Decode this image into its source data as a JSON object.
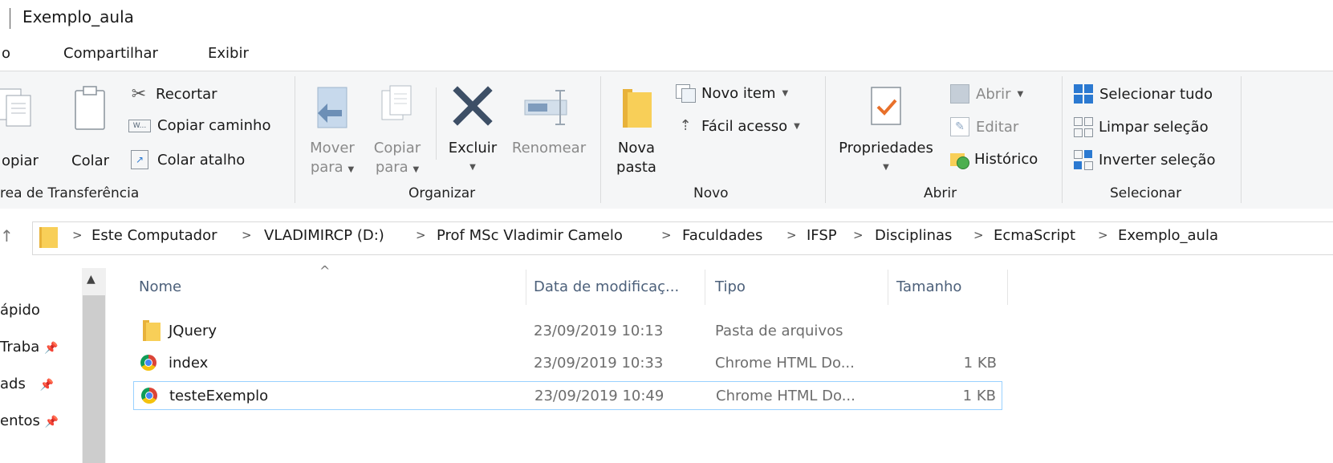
{
  "window": {
    "title": "Exemplo_aula"
  },
  "tabs": [
    {
      "label": "o"
    },
    {
      "label": "Compartilhar"
    },
    {
      "label": "Exibir"
    }
  ],
  "ribbon": {
    "clipboard": {
      "copy_label": "opiar",
      "paste_label": "Colar",
      "cut_label": "Recortar",
      "copy_path_label": "Copiar caminho",
      "paste_shortcut_label": "Colar atalho",
      "group_label": "rea de Transferência"
    },
    "organize": {
      "move_line1": "Mover",
      "move_line2": "para",
      "copy_line1": "Copiar",
      "copy_line2": "para",
      "delete_label": "Excluir",
      "rename_label": "Renomear",
      "group_label": "Organizar"
    },
    "new": {
      "new_folder_line1": "Nova",
      "new_folder_line2": "pasta",
      "new_item_label": "Novo item",
      "easy_access_label": "Fácil acesso",
      "group_label": "Novo"
    },
    "open": {
      "properties_label": "Propriedades",
      "open_label": "Abrir",
      "edit_label": "Editar",
      "history_label": "Histórico",
      "group_label": "Abrir"
    },
    "select": {
      "select_all_label": "Selecionar tudo",
      "clear_selection_label": "Limpar seleção",
      "invert_selection_label": "Inverter seleção",
      "group_label": "Selecionar"
    }
  },
  "address": {
    "crumbs": [
      "Este Computador",
      "VLADIMIRCP (D:)",
      "Prof MSc Vladimir Camelo",
      "Faculdades",
      "IFSP",
      "Disciplinas",
      "EcmaScript",
      "Exemplo_aula"
    ]
  },
  "nav": {
    "items": [
      {
        "label": "ápido",
        "pinned": false
      },
      {
        "label": "Traba",
        "pinned": true
      },
      {
        "label": "ads",
        "pinned": true
      },
      {
        "label": "entos",
        "pinned": true
      }
    ]
  },
  "list": {
    "columns": [
      "Nome",
      "Data de modificaç...",
      "Tipo",
      "Tamanho"
    ],
    "rows": [
      {
        "name": "JQuery",
        "date": "23/09/2019 10:13",
        "type": "Pasta de arquivos",
        "size": "",
        "icon": "folder-icon",
        "selected": false
      },
      {
        "name": "index",
        "date": "23/09/2019 10:33",
        "type": "Chrome HTML Do...",
        "size": "1 KB",
        "icon": "chrome-icon",
        "selected": false
      },
      {
        "name": "testeExemplo",
        "date": "23/09/2019 10:49",
        "type": "Chrome HTML Do...",
        "size": "1 KB",
        "icon": "chrome-icon",
        "selected": true
      }
    ]
  },
  "colors": {
    "accent_blue": "#2b79d1",
    "selection_border": "#99d1ff",
    "folder_yellow": "#f8cf58"
  }
}
